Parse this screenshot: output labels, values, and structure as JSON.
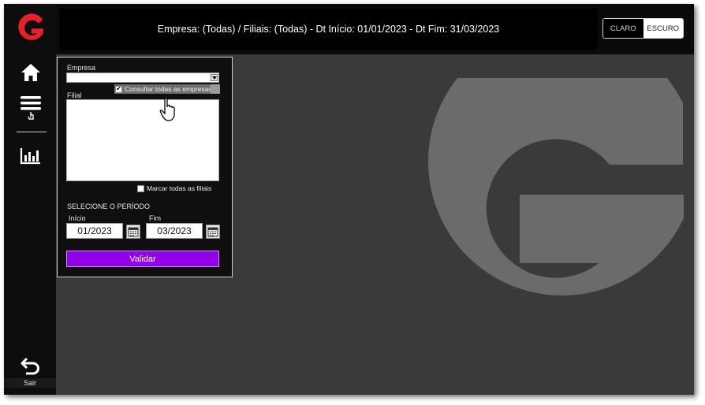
{
  "header": {
    "text": "Empresa: (Todas) / Filiais: (Todas) - Dt Início: 01/01/2023 - Dt Fim: 31/03/2023"
  },
  "theme": {
    "light_label": "CLARO",
    "dark_label": "ESCURO",
    "selected": "ESCURO"
  },
  "sidebar": {
    "items": [
      {
        "icon": "home-icon"
      },
      {
        "icon": "menu-icon"
      },
      {
        "icon": "bar-chart-icon"
      }
    ],
    "exit_label": "Sair"
  },
  "filter": {
    "empresa_label": "Empresa",
    "empresa_value": "",
    "all_companies_label": "Consultar todas as empresas",
    "all_companies_checked": true,
    "filial_label": "Filial",
    "all_branches_label": "Marcar todas as filiais",
    "all_branches_checked": false,
    "period_title": "SELECIONE O PERÍODO",
    "start_label": "Início",
    "start_value": "01/2023",
    "end_label": "Fim",
    "end_value": "03/2023",
    "validate_label": "Validar"
  },
  "colors": {
    "brand_red": "#e8202a",
    "accent_purple": "#9100e6",
    "background_dark": "#3a3a3a"
  }
}
